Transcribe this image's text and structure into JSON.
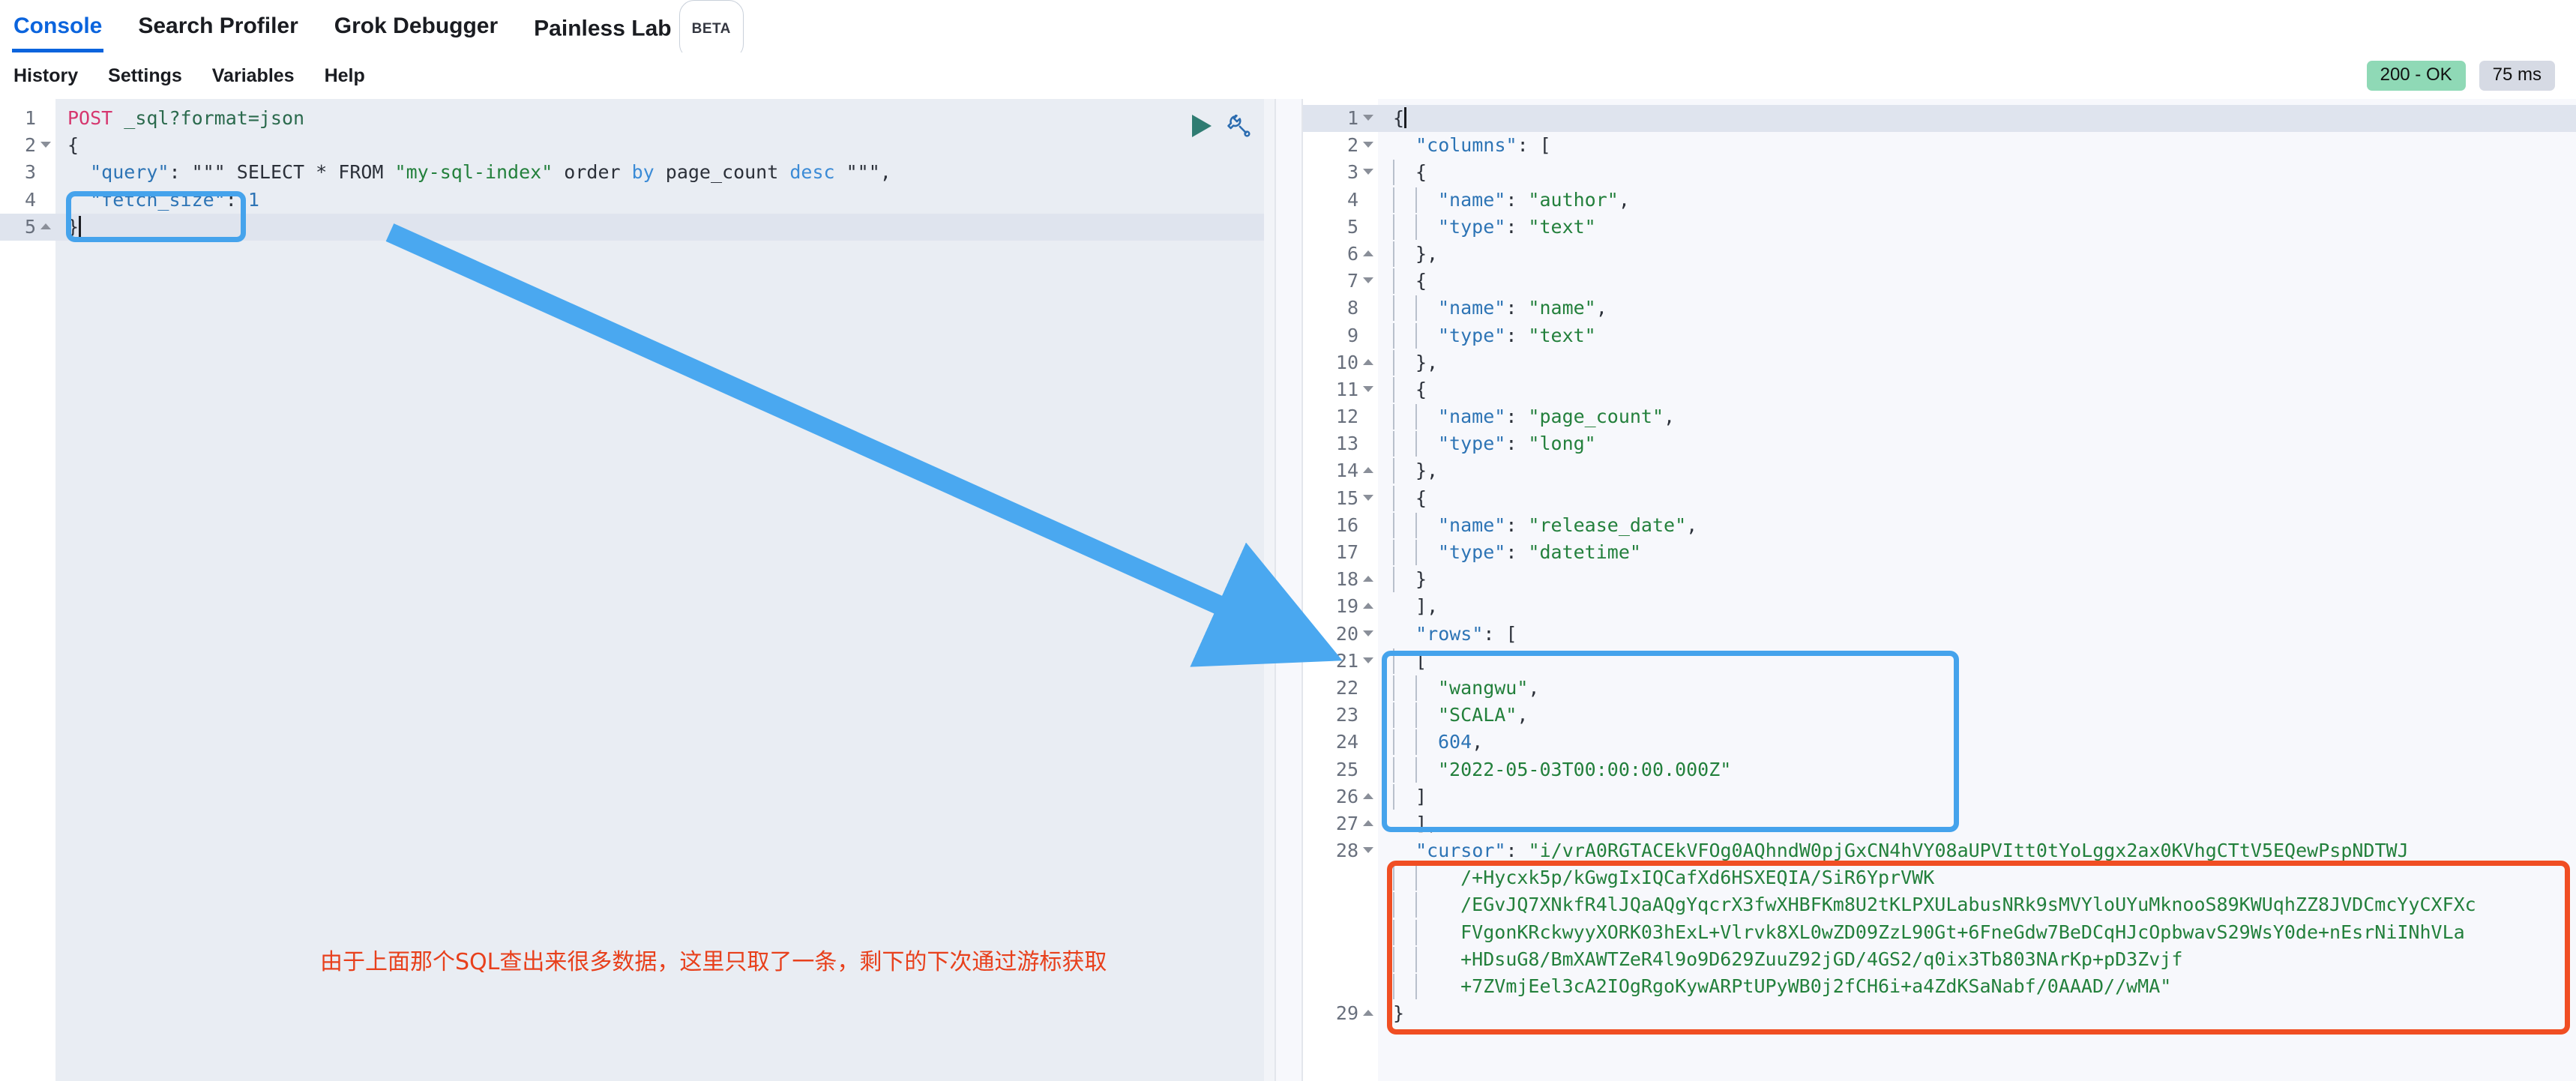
{
  "topnav": {
    "items": [
      {
        "label": "Console",
        "active": true,
        "badge": null
      },
      {
        "label": "Search Profiler",
        "active": false,
        "badge": null
      },
      {
        "label": "Grok Debugger",
        "active": false,
        "badge": null
      },
      {
        "label": "Painless Lab",
        "active": false,
        "badge": "BETA"
      }
    ]
  },
  "toolbar": {
    "items": [
      {
        "label": "History"
      },
      {
        "label": "Settings"
      },
      {
        "label": "Variables"
      },
      {
        "label": "Help"
      }
    ],
    "status_badge": "200 - OK",
    "time_badge": "75 ms",
    "play_icon": "play-icon",
    "wrench_icon": "wrench-icon"
  },
  "request_editor": {
    "line_numbers": [
      "1",
      "2",
      "3",
      "4",
      "5"
    ],
    "fold_markers": {
      "2": "down",
      "5": "up"
    },
    "current_line": 5,
    "lines": [
      {
        "n": 1,
        "tokens": [
          {
            "t": "POST ",
            "c": "t-method"
          },
          {
            "t": "_sql?format=json",
            "c": "t-url"
          }
        ]
      },
      {
        "n": 2,
        "tokens": [
          {
            "t": "{",
            "c": "t-punc"
          }
        ]
      },
      {
        "n": 3,
        "tokens": [
          {
            "t": "  \"query\"",
            "c": "t-key"
          },
          {
            "t": ": ",
            "c": "t-punc"
          },
          {
            "t": "\"\"\" ",
            "c": "t-plain"
          },
          {
            "t": "SELECT ",
            "c": "t-plain"
          },
          {
            "t": "* ",
            "c": "t-plain"
          },
          {
            "t": "FROM ",
            "c": "t-plain"
          },
          {
            "t": "\"my-sql-index\"",
            "c": "t-str"
          },
          {
            "t": " order ",
            "c": "t-plain"
          },
          {
            "t": "by ",
            "c": "t-kw"
          },
          {
            "t": "page_count ",
            "c": "t-plain"
          },
          {
            "t": "desc ",
            "c": "t-kw"
          },
          {
            "t": "\"\"\"",
            "c": "t-plain"
          },
          {
            "t": ",",
            "c": "t-punc"
          }
        ]
      },
      {
        "n": 4,
        "tokens": [
          {
            "t": "  \"fetch_size\"",
            "c": "t-key"
          },
          {
            "t": ": ",
            "c": "t-punc"
          },
          {
            "t": "1",
            "c": "t-num"
          }
        ]
      },
      {
        "n": 5,
        "tokens": [
          {
            "t": "}",
            "c": "t-punc"
          }
        ]
      }
    ]
  },
  "response_editor": {
    "current_line": 1,
    "lines": [
      {
        "n": 1,
        "fold": "down",
        "indent": 0,
        "tokens": [
          {
            "t": "{",
            "c": "t-punc"
          }
        ]
      },
      {
        "n": 2,
        "fold": "down",
        "indent": 0,
        "tokens": [
          {
            "t": "  \"columns\"",
            "c": "t-key"
          },
          {
            "t": ": [",
            "c": "t-punc"
          }
        ]
      },
      {
        "n": 3,
        "fold": "down",
        "indent": 1,
        "tokens": [
          {
            "t": "{",
            "c": "t-punc"
          }
        ]
      },
      {
        "n": 4,
        "fold": null,
        "indent": 2,
        "tokens": [
          {
            "t": "\"name\"",
            "c": "t-key"
          },
          {
            "t": ": ",
            "c": "t-punc"
          },
          {
            "t": "\"author\"",
            "c": "t-str"
          },
          {
            "t": ",",
            "c": "t-punc"
          }
        ]
      },
      {
        "n": 5,
        "fold": null,
        "indent": 2,
        "tokens": [
          {
            "t": "\"type\"",
            "c": "t-key"
          },
          {
            "t": ": ",
            "c": "t-punc"
          },
          {
            "t": "\"text\"",
            "c": "t-str"
          }
        ]
      },
      {
        "n": 6,
        "fold": "up",
        "indent": 1,
        "tokens": [
          {
            "t": "},",
            "c": "t-punc"
          }
        ]
      },
      {
        "n": 7,
        "fold": "down",
        "indent": 1,
        "tokens": [
          {
            "t": "{",
            "c": "t-punc"
          }
        ]
      },
      {
        "n": 8,
        "fold": null,
        "indent": 2,
        "tokens": [
          {
            "t": "\"name\"",
            "c": "t-key"
          },
          {
            "t": ": ",
            "c": "t-punc"
          },
          {
            "t": "\"name\"",
            "c": "t-str"
          },
          {
            "t": ",",
            "c": "t-punc"
          }
        ]
      },
      {
        "n": 9,
        "fold": null,
        "indent": 2,
        "tokens": [
          {
            "t": "\"type\"",
            "c": "t-key"
          },
          {
            "t": ": ",
            "c": "t-punc"
          },
          {
            "t": "\"text\"",
            "c": "t-str"
          }
        ]
      },
      {
        "n": 10,
        "fold": "up",
        "indent": 1,
        "tokens": [
          {
            "t": "},",
            "c": "t-punc"
          }
        ]
      },
      {
        "n": 11,
        "fold": "down",
        "indent": 1,
        "tokens": [
          {
            "t": "{",
            "c": "t-punc"
          }
        ]
      },
      {
        "n": 12,
        "fold": null,
        "indent": 2,
        "tokens": [
          {
            "t": "\"name\"",
            "c": "t-key"
          },
          {
            "t": ": ",
            "c": "t-punc"
          },
          {
            "t": "\"page_count\"",
            "c": "t-str"
          },
          {
            "t": ",",
            "c": "t-punc"
          }
        ]
      },
      {
        "n": 13,
        "fold": null,
        "indent": 2,
        "tokens": [
          {
            "t": "\"type\"",
            "c": "t-key"
          },
          {
            "t": ": ",
            "c": "t-punc"
          },
          {
            "t": "\"long\"",
            "c": "t-str"
          }
        ]
      },
      {
        "n": 14,
        "fold": "up",
        "indent": 1,
        "tokens": [
          {
            "t": "},",
            "c": "t-punc"
          }
        ]
      },
      {
        "n": 15,
        "fold": "down",
        "indent": 1,
        "tokens": [
          {
            "t": "{",
            "c": "t-punc"
          }
        ]
      },
      {
        "n": 16,
        "fold": null,
        "indent": 2,
        "tokens": [
          {
            "t": "\"name\"",
            "c": "t-key"
          },
          {
            "t": ": ",
            "c": "t-punc"
          },
          {
            "t": "\"release_date\"",
            "c": "t-str"
          },
          {
            "t": ",",
            "c": "t-punc"
          }
        ]
      },
      {
        "n": 17,
        "fold": null,
        "indent": 2,
        "tokens": [
          {
            "t": "\"type\"",
            "c": "t-key"
          },
          {
            "t": ": ",
            "c": "t-punc"
          },
          {
            "t": "\"datetime\"",
            "c": "t-str"
          }
        ]
      },
      {
        "n": 18,
        "fold": "up",
        "indent": 1,
        "tokens": [
          {
            "t": "}",
            "c": "t-punc"
          }
        ]
      },
      {
        "n": 19,
        "fold": "up",
        "indent": 0,
        "tokens": [
          {
            "t": "  ],",
            "c": "t-punc"
          }
        ]
      },
      {
        "n": 20,
        "fold": "down",
        "indent": 0,
        "tokens": [
          {
            "t": "  \"rows\"",
            "c": "t-key"
          },
          {
            "t": ": [",
            "c": "t-punc"
          }
        ]
      },
      {
        "n": 21,
        "fold": "down",
        "indent": 1,
        "tokens": [
          {
            "t": "[",
            "c": "t-punc"
          }
        ]
      },
      {
        "n": 22,
        "fold": null,
        "indent": 2,
        "tokens": [
          {
            "t": "\"wangwu\"",
            "c": "t-str"
          },
          {
            "t": ",",
            "c": "t-punc"
          }
        ]
      },
      {
        "n": 23,
        "fold": null,
        "indent": 2,
        "tokens": [
          {
            "t": "\"SCALA\"",
            "c": "t-str"
          },
          {
            "t": ",",
            "c": "t-punc"
          }
        ]
      },
      {
        "n": 24,
        "fold": null,
        "indent": 2,
        "tokens": [
          {
            "t": "604",
            "c": "t-num"
          },
          {
            "t": ",",
            "c": "t-punc"
          }
        ]
      },
      {
        "n": 25,
        "fold": null,
        "indent": 2,
        "tokens": [
          {
            "t": "\"2022-05-03T00:00:00.000Z\"",
            "c": "t-str"
          }
        ]
      },
      {
        "n": 26,
        "fold": "up",
        "indent": 1,
        "tokens": [
          {
            "t": "]",
            "c": "t-punc"
          }
        ]
      },
      {
        "n": 27,
        "fold": "up",
        "indent": 0,
        "tokens": [
          {
            "t": "  ],",
            "c": "t-punc"
          }
        ]
      },
      {
        "n": 28,
        "fold": "down",
        "indent": 0,
        "tokens": [
          {
            "t": "  \"cursor\"",
            "c": "t-key"
          },
          {
            "t": ": ",
            "c": "t-punc"
          },
          {
            "t": "\"i/vrA0RGTACEkVFOg0AQhndW0pjGxCN4hVY08aUPVItt0tYoLggx2ax0KVhgCTtV5EQewPspNDTWJ",
            "c": "t-str"
          }
        ]
      },
      {
        "n": "28w1",
        "fold": null,
        "indent": 0,
        "wrap": true,
        "tokens": [
          {
            "t": "/+Hycxk5p/kGwgIxIQCafXd6HSXEQIA/SiR6YprVWK",
            "c": "t-str"
          }
        ]
      },
      {
        "n": "28w2",
        "fold": null,
        "indent": 0,
        "wrap": true,
        "tokens": [
          {
            "t": "/EGvJQ7XNkfR4lJQaAQgYqcrX3fwXHBFKm8U2tKLPXULabusNRk9sMVYloUYuMknooS89KWUqhZZ8JVDCmcYyCXFXc",
            "c": "t-str"
          }
        ]
      },
      {
        "n": "28w3",
        "fold": null,
        "indent": 0,
        "wrap": true,
        "tokens": [
          {
            "t": "FVgonKRckwyyXORK03hExL+Vlrvk8XL0wZD09ZzL90Gt+6FneGdw7BeDCqHJcOpbwavS29WsY0de+nEsrNiINhVLa",
            "c": "t-str"
          }
        ]
      },
      {
        "n": "28w4",
        "fold": null,
        "indent": 0,
        "wrap": true,
        "tokens": [
          {
            "t": "+HDsuG8/BmXAWTZeR4l9o9D629ZuuZ92jGD/4GS2/q0ix3Tb803NArKp+pD3Zvjf",
            "c": "t-str"
          }
        ]
      },
      {
        "n": "28w5",
        "fold": null,
        "indent": 0,
        "wrap": true,
        "tokens": [
          {
            "t": "+7ZVmjEel3cA2IOgRgoKywARPtUPyWB0j2fCH6i+a4ZdKSaNabf/0AAAD//wMA\"",
            "c": "t-str"
          }
        ]
      },
      {
        "n": 29,
        "fold": "up",
        "indent": 0,
        "tokens": [
          {
            "t": "}",
            "c": "t-punc"
          }
        ]
      }
    ]
  },
  "annotations": {
    "note_text": "由于上面那个SQL查出来很多数据，这里只取了一条，剩下的下次通过游标获取",
    "note_color": "#e8401c",
    "highlight_blue": "#45a3ec",
    "highlight_red": "#f04e23",
    "arrow_color": "#4aa8f0",
    "boxes": [
      {
        "name": "fetch-size-highlight",
        "color": "#45a3ec"
      },
      {
        "name": "rows-highlight",
        "color": "#45a3ec"
      },
      {
        "name": "cursor-highlight",
        "color": "#f04e23"
      }
    ]
  }
}
